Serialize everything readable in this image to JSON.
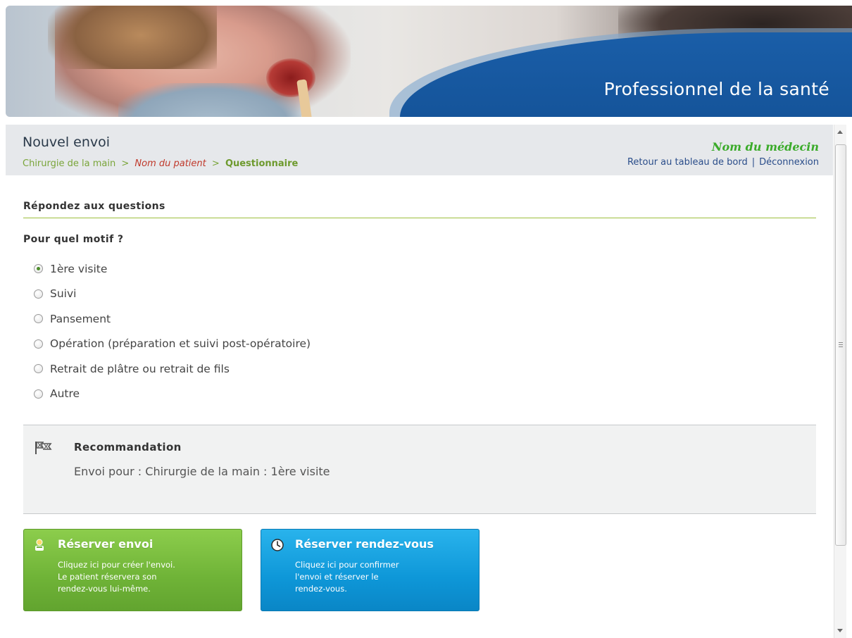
{
  "banner": {
    "title": "Professionnel de la santé"
  },
  "header": {
    "page_title": "Nouvel envoi",
    "breadcrumb": {
      "speciality": "Chirurgie de la main",
      "sep": ">",
      "patient": "Nom du patient",
      "current": "Questionnaire"
    },
    "doctor_name": "Nom du médecin",
    "links": {
      "dashboard": "Retour au tableau de bord",
      "sep": "|",
      "logout": "Déconnexion"
    }
  },
  "form": {
    "section_title": "Répondez aux questions",
    "question": "Pour quel motif ?",
    "options": [
      {
        "label": "1ère visite",
        "selected": true
      },
      {
        "label": "Suivi",
        "selected": false
      },
      {
        "label": "Pansement",
        "selected": false
      },
      {
        "label": "Opération (préparation et suivi post-opératoire)",
        "selected": false
      },
      {
        "label": "Retrait de plâtre ou retrait de fils",
        "selected": false
      },
      {
        "label": "Autre",
        "selected": false
      }
    ]
  },
  "recommendation": {
    "title": "Recommandation",
    "text": "Envoi pour : Chirurgie de la main : 1ère visite",
    "icon": "flag-icon"
  },
  "actions": {
    "reserve_envoi": {
      "title": "Réserver envoi",
      "desc_line1": "Cliquez ici pour créer l'envoi.",
      "desc_line2": "Le patient réservera son",
      "desc_line3": "rendez-vous lui-même.",
      "icon": "person-icon",
      "color": "#6fb337"
    },
    "reserve_rdv": {
      "title": "Réserver rendez-vous",
      "desc_line1": "Cliquez ici pour confirmer",
      "desc_line2": "l'envoi et réserver le",
      "desc_line3": "rendez-vous.",
      "icon": "clock-icon",
      "color": "#0e97d8"
    }
  },
  "colors": {
    "brand_blue": "#124f93",
    "accent_green": "#9cbf3d",
    "doctor_green": "#3bab2a",
    "patient_red": "#c0392b"
  }
}
